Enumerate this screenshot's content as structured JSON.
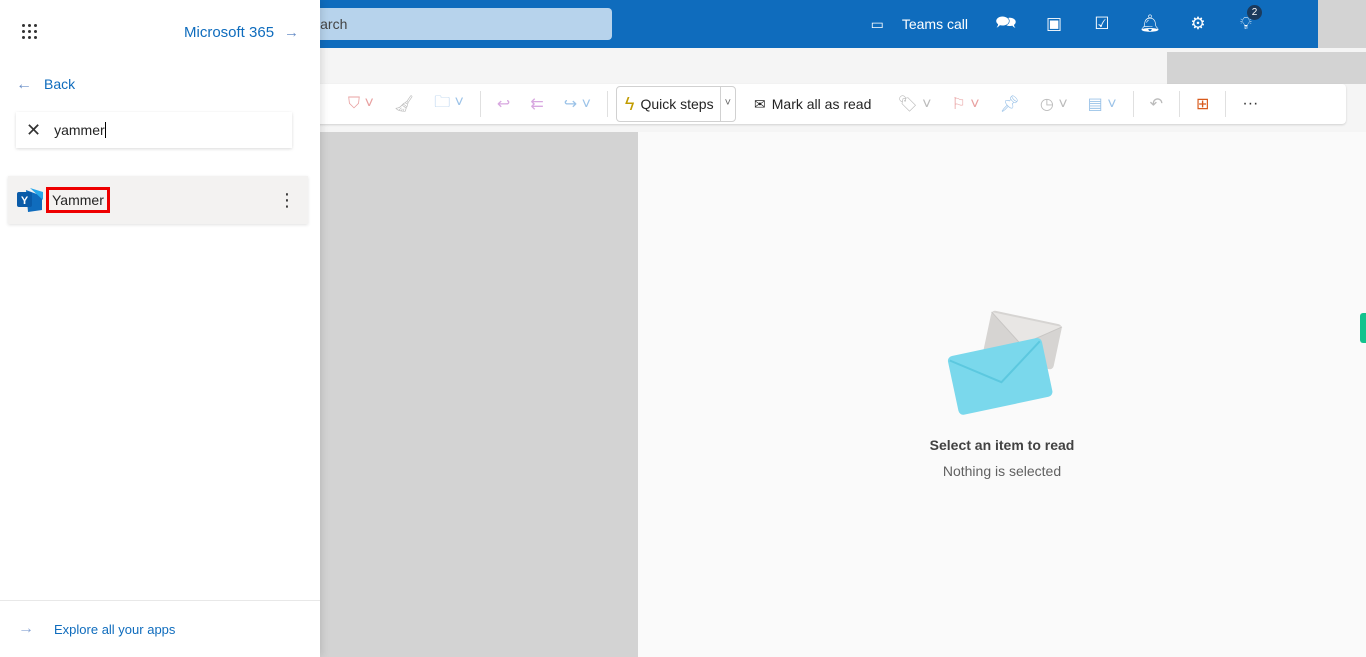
{
  "header": {
    "search_placeholder": "Search",
    "search_visible": "earch",
    "teams_call": "Teams call",
    "tips_badge": "2"
  },
  "toolbar": {
    "quick_steps": "Quick steps",
    "mark_all_read": "Mark all as read",
    "more": "···"
  },
  "reading": {
    "title": "Select an item to read",
    "subtitle": "Nothing is selected"
  },
  "panel": {
    "title": "Microsoft 365",
    "back": "Back",
    "search_value": "yammer",
    "result": "Yammer",
    "explore": "Explore all your apps"
  },
  "colors": {
    "brand": "#0f6cbd",
    "highlight": "#e00000",
    "envelope_front": "#7ad8ec",
    "envelope_back": "#d6d4d2"
  }
}
